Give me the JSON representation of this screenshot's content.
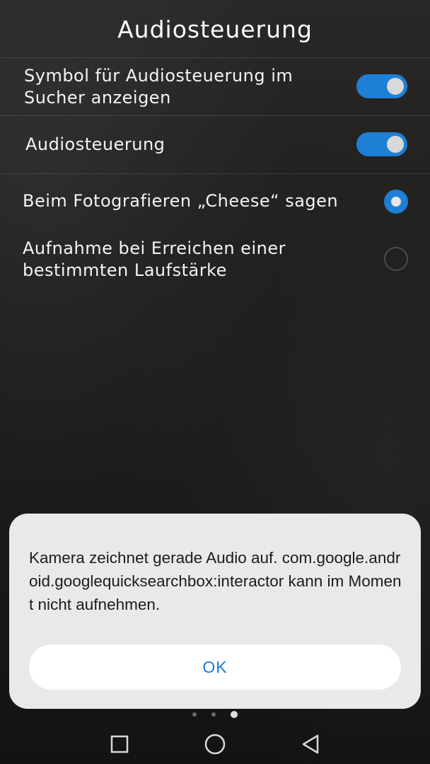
{
  "header": {
    "title": "Audiosteuerung"
  },
  "settings": [
    {
      "label_line1": "Symbol für Audiosteuerung im",
      "label_line2": "Sucher anzeigen",
      "control": "toggle",
      "on": true
    },
    {
      "label_line1": "Audiosteuerung",
      "control": "toggle",
      "on": true
    },
    {
      "label_line1": "Beim Fotografieren „Cheese“ sagen",
      "control": "radio",
      "on": true
    },
    {
      "label_line1": "Aufnahme bei Erreichen einer",
      "label_line2": "bestimmten Laufstärke",
      "control": "radio",
      "on": false
    }
  ],
  "dialog": {
    "message": "Kamera zeichnet gerade Audio auf. com.google.android.googlequicksearchbox:interactor kann im Moment nicht aufnehmen.",
    "ok_label": "OK"
  },
  "pager": {
    "count": 3,
    "active_index": 2
  },
  "navbar": {
    "icons": [
      "square-icon",
      "circle-icon",
      "triangle-back-icon"
    ]
  },
  "colors": {
    "accent": "#1e7fd6",
    "dialog_bg": "#e9e9e9",
    "ok_text": "#1a7ad6"
  }
}
